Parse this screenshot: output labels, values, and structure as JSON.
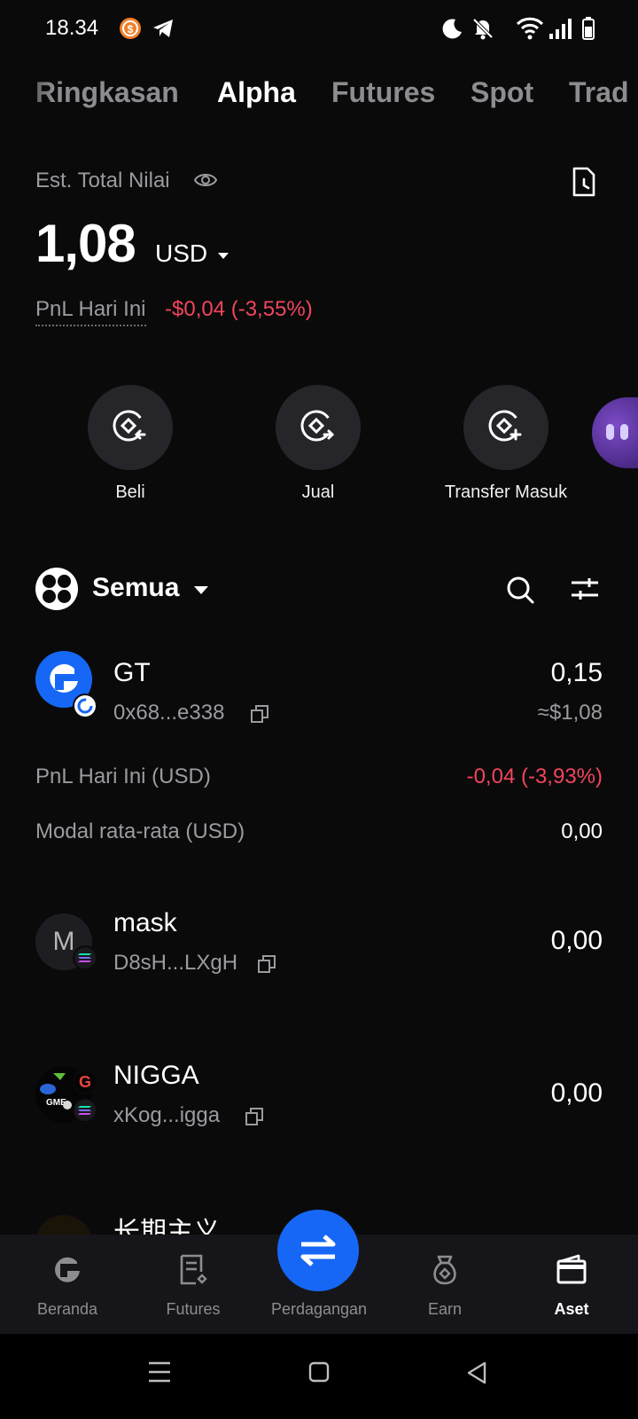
{
  "status_bar": {
    "time": "18.34",
    "icons": [
      "notification-coin-icon",
      "telegram-icon",
      "moon-icon",
      "bell-off-icon",
      "wifi-icon",
      "signal-icon",
      "battery-icon"
    ]
  },
  "tabs": [
    {
      "label": "Ringkasan",
      "active": false
    },
    {
      "label": "Alpha",
      "active": true
    },
    {
      "label": "Futures",
      "active": false
    },
    {
      "label": "Spot",
      "active": false
    },
    {
      "label": "Trad",
      "active": false
    }
  ],
  "summary": {
    "total_label": "Est. Total Nilai",
    "total_value": "1,08",
    "currency": "USD",
    "pnl_label": "PnL Hari Ini",
    "pnl_value": "-$0,04 (-3,55%)"
  },
  "actions": [
    {
      "label": "Beli",
      "icon": "buy-coin-icon"
    },
    {
      "label": "Jual",
      "icon": "sell-coin-icon"
    },
    {
      "label": "Transfer Masuk",
      "icon": "transfer-in-coin-icon"
    }
  ],
  "filter": {
    "label": "Semua"
  },
  "assets": [
    {
      "name": "GT",
      "address": "0x68...e338",
      "amount": "0,15",
      "usd": "≈$1,08",
      "details": [
        {
          "label": "PnL Hari Ini (USD)",
          "value": "-0,04 (-3,93%)"
        },
        {
          "label": "Modal rata-rata (USD)",
          "value": "0,00"
        }
      ]
    },
    {
      "name": "mask",
      "address": "D8sH...LXgH",
      "amount": "0,00",
      "logo_letter": "M"
    },
    {
      "name": "NIGGA",
      "address": "xKog...igga",
      "amount": "0,00"
    },
    {
      "name": "长期主义",
      "address": "",
      "amount": ""
    }
  ],
  "bottom_nav": [
    {
      "label": "Beranda",
      "icon": "home-logo-icon",
      "active": false
    },
    {
      "label": "Futures",
      "icon": "futures-doc-icon",
      "active": false
    },
    {
      "label": "Perdagangan",
      "icon": "swap-arrows-icon",
      "active": false
    },
    {
      "label": "Earn",
      "icon": "earn-bag-icon",
      "active": false
    },
    {
      "label": "Aset",
      "icon": "wallet-icon",
      "active": true
    }
  ],
  "colors": {
    "background": "#0a0a0b",
    "negative": "#f2455c",
    "accent": "#1667f5",
    "muted": "#9b9ba0"
  }
}
